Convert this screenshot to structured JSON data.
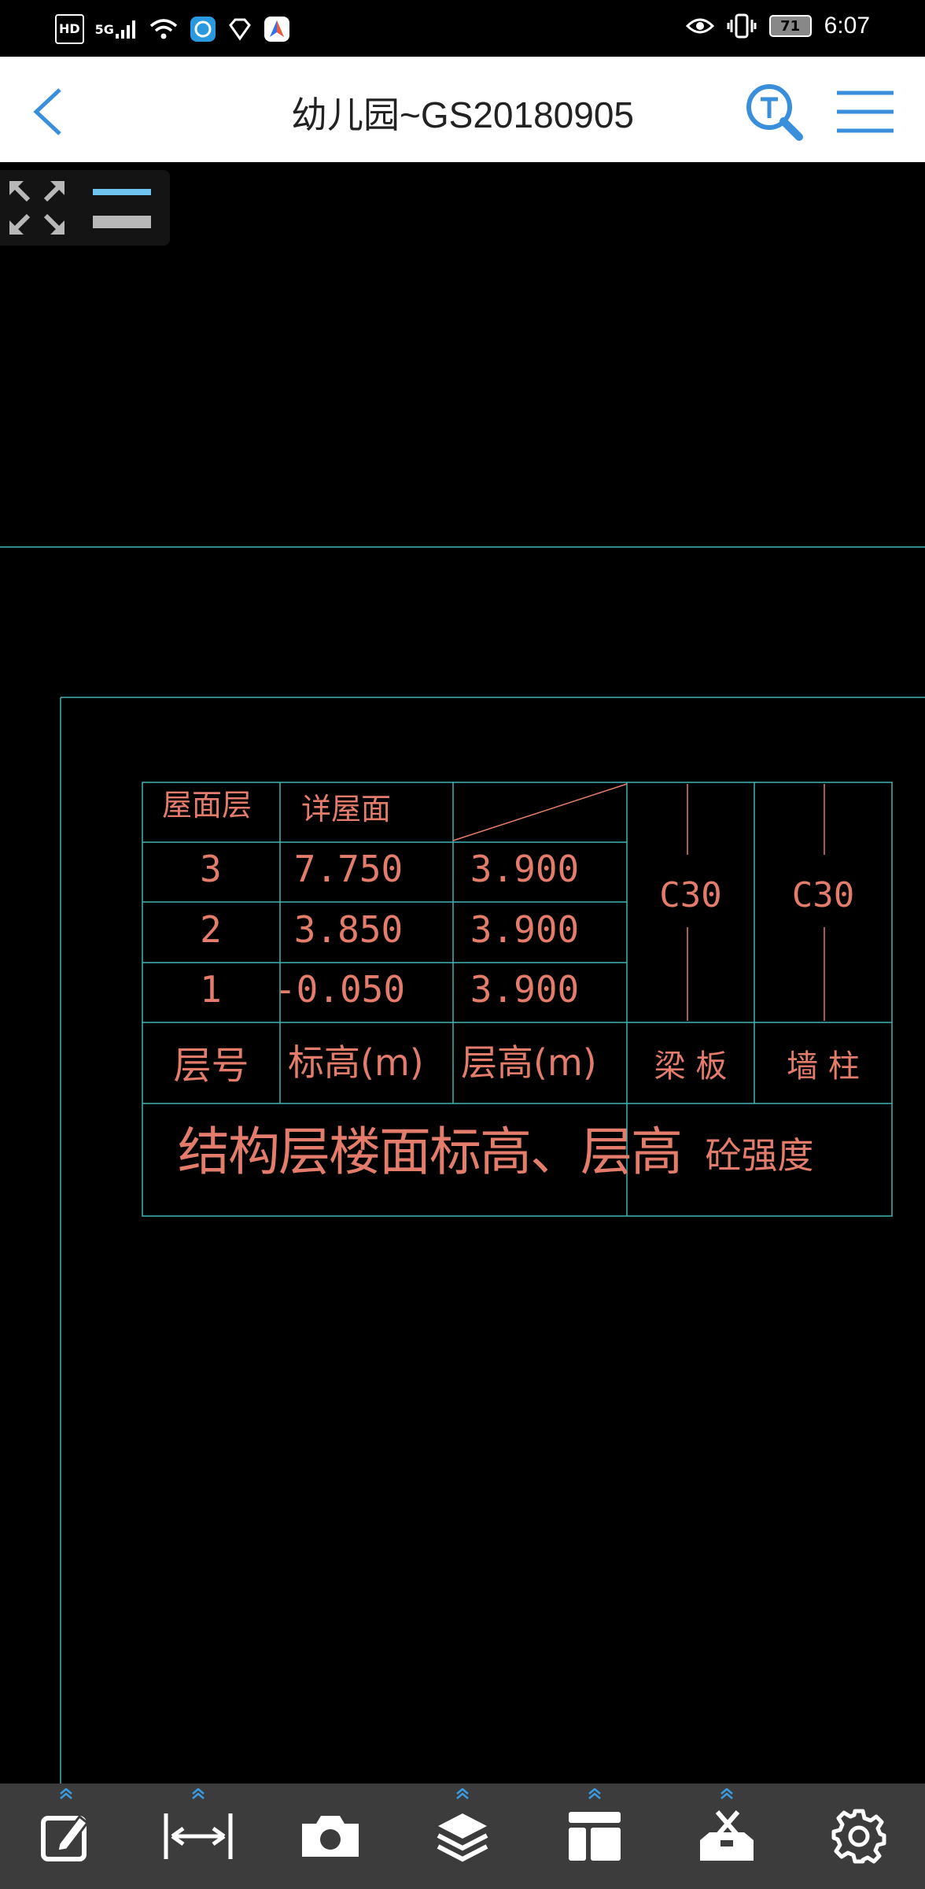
{
  "status_bar": {
    "left_icons": [
      "hd-icon",
      "signal-5g-icon",
      "wifi-icon",
      "app-notification-icon",
      "diamond-icon",
      "maps-icon"
    ],
    "hd_label": "HD",
    "network_label": "5G",
    "battery_level": "71",
    "time": "6:07"
  },
  "header": {
    "title": "幼儿园~GS20180905",
    "accent_color": "#3a8fdc"
  },
  "drawing": {
    "line_color": "#3fb4b4",
    "text_color": "#e37c6a",
    "table": {
      "rows": [
        {
          "floor": "屋面层",
          "elevation": "详屋面",
          "height": ""
        },
        {
          "floor": "3",
          "elevation": "7.750",
          "height": "3.900"
        },
        {
          "floor": "2",
          "elevation": "3.850",
          "height": "3.900"
        },
        {
          "floor": "1",
          "elevation": "-0.050",
          "height": "3.900"
        }
      ],
      "beam_slab_grade": "C30",
      "wall_column_grade": "C30",
      "header_floor": "层号",
      "header_elevation": "标高(m)",
      "header_height": "层高(m)",
      "header_beam_slab": "梁 板",
      "header_wall_column": "墙 柱",
      "footer_left": "结构层楼面标高、层高",
      "footer_right": "砼强度"
    }
  },
  "toolbar": {
    "tools": [
      "edit-icon",
      "measure-icon",
      "camera-icon",
      "layers-icon",
      "layout-icon",
      "toolbox-icon",
      "settings-icon"
    ]
  }
}
